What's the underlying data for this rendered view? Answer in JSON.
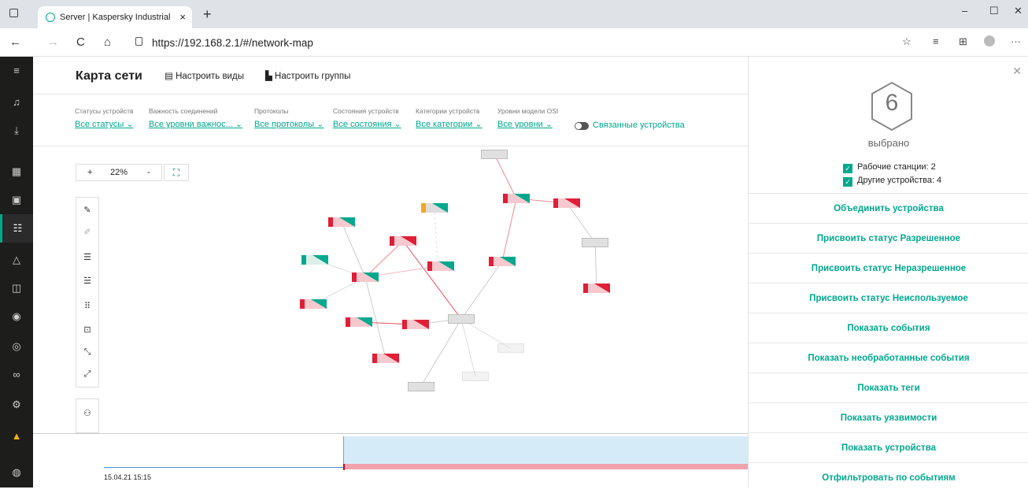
{
  "browser": {
    "tab_title": "Server | Kaspersky Industrial Cyb",
    "tab_close": "×",
    "new_tab": "+",
    "url": "https://192.168.2.1/#/network-map",
    "win_min": "–",
    "win_max": "☐",
    "win_close": "✕",
    "back": "←",
    "forward": "→",
    "reload": "C",
    "home": "⌂",
    "more": "···"
  },
  "header": {
    "title": "Карта сети",
    "configure_views": "Настроить виды",
    "configure_groups": "Настроить группы"
  },
  "filters": [
    {
      "label": "Статусы устройств",
      "value": "Все статусы ⌄"
    },
    {
      "label": "Важность соединений",
      "value": "Все уровни важнос... ⌄"
    },
    {
      "label": "Протоколы",
      "value": "Все протоколы ⌄"
    },
    {
      "label": "Состояния устройств",
      "value": "Все состояния ⌄"
    },
    {
      "label": "Категории устройств",
      "value": "Все категории ⌄"
    },
    {
      "label": "Уровни модели OSI",
      "value": "Все уровни ⌄"
    }
  ],
  "related_devices": "Связанные устройства",
  "zoom": {
    "plus": "+",
    "level": "22%",
    "minus": "-"
  },
  "timeline": {
    "date": "15.04.21 15:15"
  },
  "panel": {
    "count": "6",
    "selected_label": "выбрано",
    "checks": [
      {
        "label": "Рабочие станции: 2"
      },
      {
        "label": "Другие устройства: 4"
      }
    ],
    "actions": [
      "Объединить устройства",
      "Присвоить статус Разрешенное",
      "Присвоить статус Неразрешенное",
      "Присвоить статус Неиспользуемое",
      "Показать события",
      "Показать необработанные события",
      "Показать теги",
      "Показать уязвимости",
      "Показать устройства",
      "Отфильтровать по событиям"
    ]
  },
  "colors": {
    "accent": "#00a88e",
    "danger": "#d0021b",
    "warning": "#f5a623"
  }
}
